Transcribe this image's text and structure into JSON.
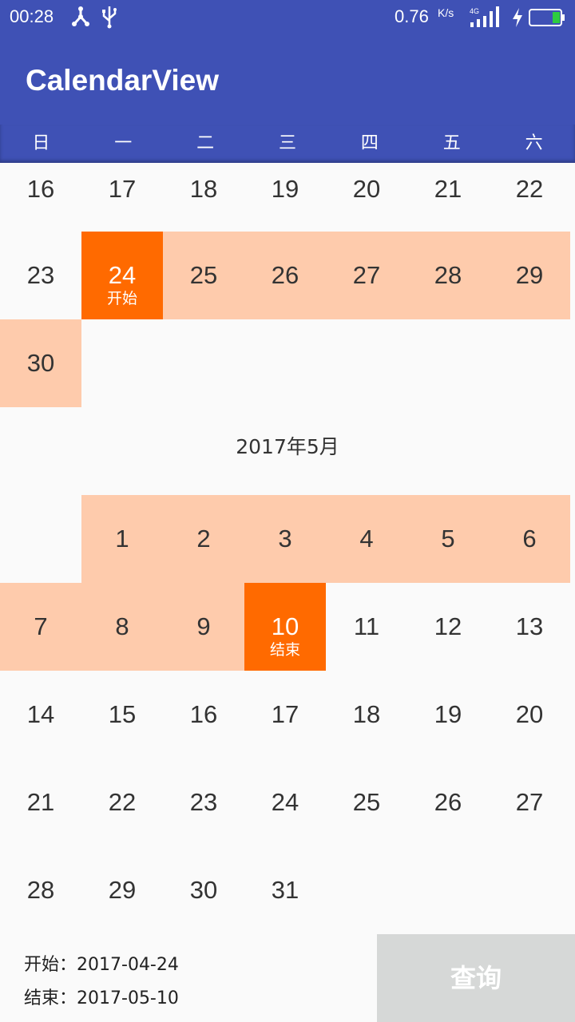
{
  "status_bar": {
    "time": "00:28",
    "net_speed": "0.76",
    "net_speed_unit": "K/s",
    "network_type": "4G",
    "icons": [
      "share-icon",
      "usb-icon",
      "signal-icon",
      "charging-icon",
      "battery-icon"
    ]
  },
  "app_bar": {
    "title": "CalendarView"
  },
  "colors": {
    "primary": "#3f51b5",
    "selected": "#ff6a00",
    "range": "#fecbac",
    "button": "#d6d8d7"
  },
  "weekdays": [
    "日",
    "一",
    "二",
    "三",
    "四",
    "五",
    "六"
  ],
  "april_rows": [
    [
      {
        "day": "16",
        "state": "plain"
      },
      {
        "day": "17",
        "state": "plain"
      },
      {
        "day": "18",
        "state": "plain"
      },
      {
        "day": "19",
        "state": "plain"
      },
      {
        "day": "20",
        "state": "plain"
      },
      {
        "day": "21",
        "state": "plain"
      },
      {
        "day": "22",
        "state": "plain"
      }
    ],
    [
      {
        "day": "23",
        "state": "plain"
      },
      {
        "day": "24",
        "state": "sel",
        "tag": "开始"
      },
      {
        "day": "25",
        "state": "range"
      },
      {
        "day": "26",
        "state": "range"
      },
      {
        "day": "27",
        "state": "range"
      },
      {
        "day": "28",
        "state": "range"
      },
      {
        "day": "29",
        "state": "range"
      }
    ],
    [
      {
        "day": "30",
        "state": "range"
      }
    ]
  ],
  "may": {
    "title": "2017年5月",
    "rows": [
      [
        null,
        {
          "day": "1",
          "state": "range"
        },
        {
          "day": "2",
          "state": "range"
        },
        {
          "day": "3",
          "state": "range"
        },
        {
          "day": "4",
          "state": "range"
        },
        {
          "day": "5",
          "state": "range"
        },
        {
          "day": "6",
          "state": "range"
        }
      ],
      [
        {
          "day": "7",
          "state": "range"
        },
        {
          "day": "8",
          "state": "range"
        },
        {
          "day": "9",
          "state": "range"
        },
        {
          "day": "10",
          "state": "sel",
          "tag": "结束"
        },
        {
          "day": "11",
          "state": "plain"
        },
        {
          "day": "12",
          "state": "plain"
        },
        {
          "day": "13",
          "state": "plain"
        }
      ],
      [
        {
          "day": "14",
          "state": "plain"
        },
        {
          "day": "15",
          "state": "plain"
        },
        {
          "day": "16",
          "state": "plain"
        },
        {
          "day": "17",
          "state": "plain"
        },
        {
          "day": "18",
          "state": "plain"
        },
        {
          "day": "19",
          "state": "plain"
        },
        {
          "day": "20",
          "state": "plain"
        }
      ],
      [
        {
          "day": "21",
          "state": "plain"
        },
        {
          "day": "22",
          "state": "plain"
        },
        {
          "day": "23",
          "state": "plain"
        },
        {
          "day": "24",
          "state": "plain"
        },
        {
          "day": "25",
          "state": "plain"
        },
        {
          "day": "26",
          "state": "plain"
        },
        {
          "day": "27",
          "state": "plain"
        }
      ],
      [
        {
          "day": "28",
          "state": "plain"
        },
        {
          "day": "29",
          "state": "plain"
        },
        {
          "day": "30",
          "state": "plain"
        },
        {
          "day": "31",
          "state": "plain"
        }
      ]
    ]
  },
  "footer": {
    "start_label": "开始：",
    "start_value": "2017-04-24",
    "end_label": "结束：",
    "end_value": "2017-05-10",
    "query_label": "查询"
  }
}
